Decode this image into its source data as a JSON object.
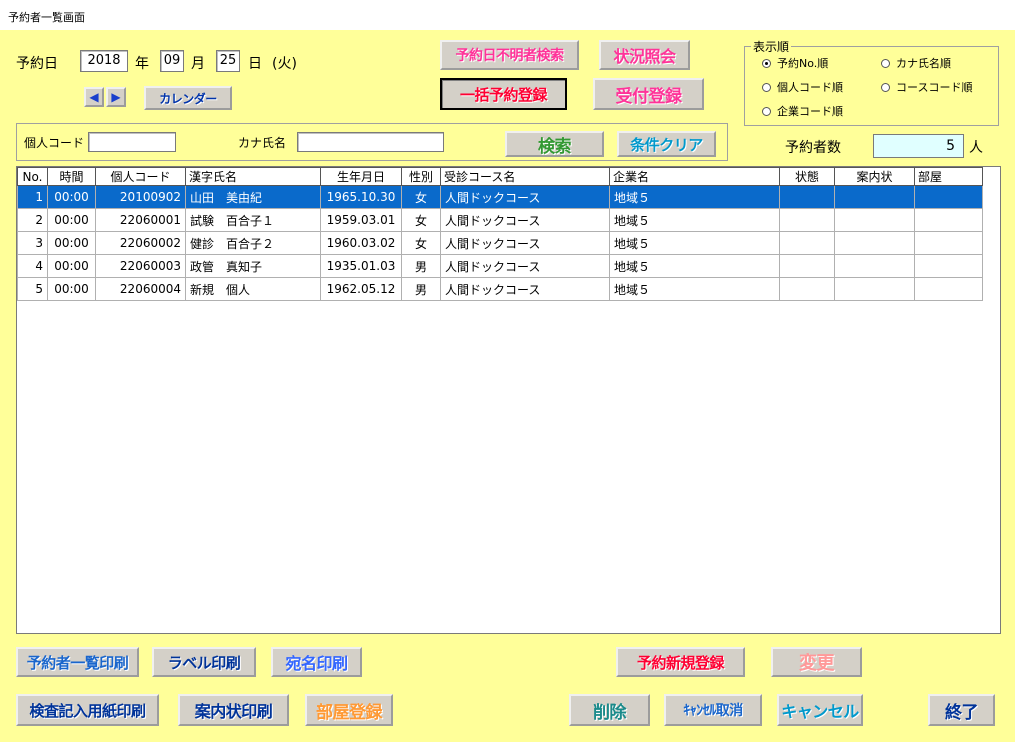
{
  "window": {
    "title": "予約者一覧画面"
  },
  "date": {
    "label": "予約日",
    "year": "2018",
    "year_unit": "年",
    "month": "09",
    "month_unit": "月",
    "day": "25",
    "day_unit": "日",
    "weekday": "(火)"
  },
  "nav": {
    "prev_icon": "◀",
    "next_icon": "▶",
    "calendar_label": "カレンダー"
  },
  "top_buttons": {
    "unknown_date_search": "予約日不明者検索",
    "status_inquiry": "状況照会",
    "bulk_register": "一括予約登録",
    "reception_register": "受付登録"
  },
  "sort": {
    "legend": "表示順",
    "options": [
      "予約No.順",
      "カナ氏名順",
      "個人コード順",
      "コースコード順",
      "企業コード順"
    ],
    "selected": "予約No.順"
  },
  "search": {
    "personal_code_label": "個人コード",
    "personal_code_value": "",
    "kana_name_label": "カナ氏名",
    "kana_name_value": "",
    "search_button": "検索",
    "clear_button": "条件クリア"
  },
  "count": {
    "label": "予約者数",
    "value": "5",
    "unit": "人"
  },
  "table": {
    "columns": [
      "No.",
      "時間",
      "個人コード",
      "漢字氏名",
      "生年月日",
      "性別",
      "受診コース名",
      "企業名",
      "状態",
      "案内状",
      "部屋"
    ],
    "rows": [
      [
        "1",
        "00:00",
        "20100902",
        "山田　美由紀",
        "1965.10.30",
        "女",
        "人間ドックコース",
        "地域５",
        "",
        "",
        ""
      ],
      [
        "2",
        "00:00",
        "22060001",
        "試験　百合子１",
        "1959.03.01",
        "女",
        "人間ドックコース",
        "地域５",
        "",
        "",
        ""
      ],
      [
        "3",
        "00:00",
        "22060002",
        "健診　百合子２",
        "1960.03.02",
        "女",
        "人間ドックコース",
        "地域５",
        "",
        "",
        ""
      ],
      [
        "4",
        "00:00",
        "22060003",
        "政管　真知子",
        "1935.01.03",
        "男",
        "人間ドックコース",
        "地域５",
        "",
        "",
        ""
      ],
      [
        "5",
        "00:00",
        "22060004",
        "新規　個人",
        "1962.05.12",
        "男",
        "人間ドックコース",
        "地域５",
        "",
        "",
        ""
      ]
    ],
    "selected_row": 0
  },
  "bottom_buttons": {
    "list_print": "予約者一覧印刷",
    "label_print": "ラベル印刷",
    "address_print": "宛名印刷",
    "new_register": "予約新規登録",
    "change": "変更",
    "exam_form_print": "検査記入用紙印刷",
    "guide_print": "案内状印刷",
    "room_register": "部屋登録",
    "delete": "削除",
    "cancel_undo": "ｷｬﾝｾﾙ取消",
    "cancel": "キャンセル",
    "exit": "終了"
  }
}
